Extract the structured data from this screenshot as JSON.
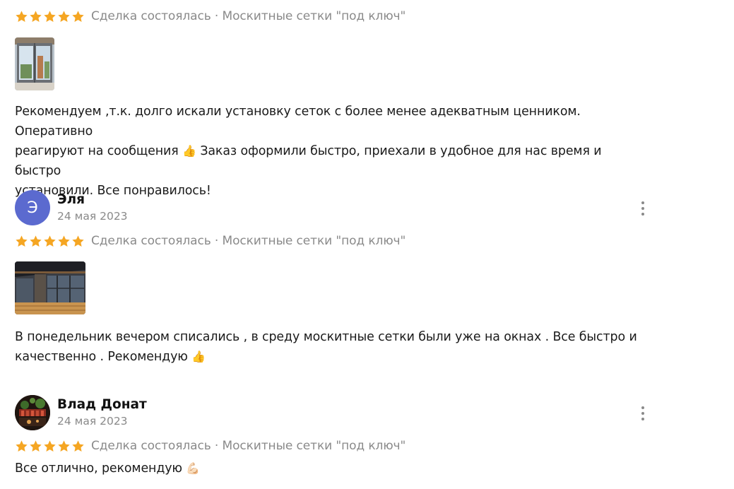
{
  "colors": {
    "star": "#F5A623",
    "meta_text": "#8a8a8a",
    "avatar_elya": "#5B6ACF",
    "body_text": "#1a1a1a"
  },
  "reviews": [
    {
      "rating": 5,
      "deal": "Сделка состоялась · Москитные сетки \"под ключ\"",
      "text_lines": [
        "Рекомендуем ,т.к. долго искали установку сеток с более менее адекватным ценником. Оперативно",
        "реагируют на сообщения",
        "Заказ оформили быстро, приехали в удобное для нас время и быстро",
        "установили. Все понравилось!"
      ],
      "emoji": "👍"
    },
    {
      "author": "Эля",
      "avatar_letter": "Э",
      "date": "24 мая 2023",
      "rating": 5,
      "deal": "Сделка состоялась · Москитные сетки \"под ключ\"",
      "text_lines": [
        "В понедельник вечером списались , в среду москитные сетки были уже на окнах . Все быстро и",
        "качественно . Рекомендую"
      ],
      "emoji": "👍"
    },
    {
      "author": "Влад Донат",
      "date": "24 мая 2023",
      "rating": 5,
      "deal": "Сделка состоялась · Москитные сетки \"под ключ\"",
      "text": "Все отлично, рекомендую",
      "emoji": "💪🏻"
    }
  ]
}
